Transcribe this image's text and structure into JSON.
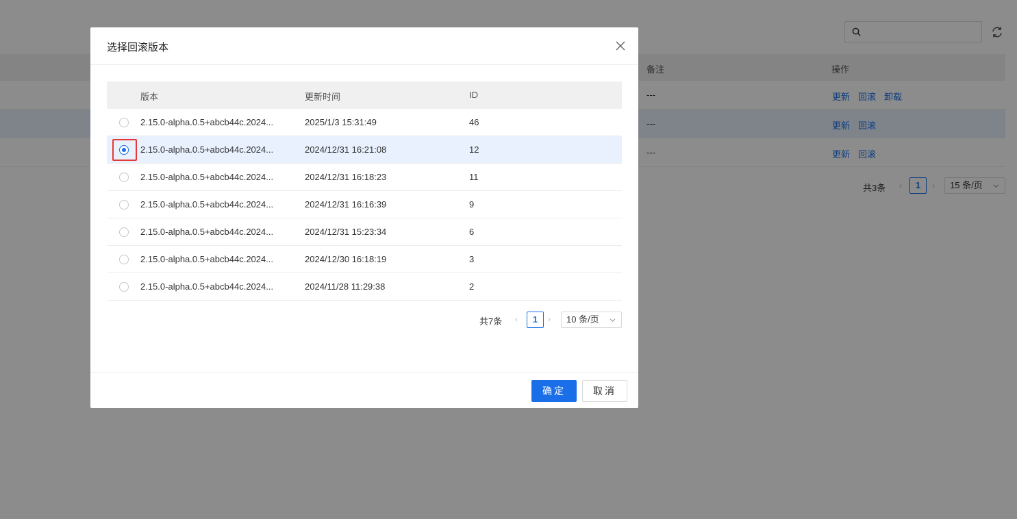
{
  "background": {
    "table_headers": {
      "remark": "备注",
      "actions": "操作"
    },
    "rows": [
      {
        "remark": "---",
        "actions": [
          "更新",
          "回滚",
          "卸载"
        ]
      },
      {
        "remark": "---",
        "actions": [
          "更新",
          "回滚"
        ]
      },
      {
        "remark": "---",
        "actions": [
          "更新",
          "回滚"
        ]
      }
    ],
    "pagination": {
      "total": "共3条",
      "page": "1",
      "page_size": "15 条/页"
    },
    "search_icon": "search-icon",
    "refresh_icon": "refresh-icon"
  },
  "modal": {
    "title": "选择回滚版本",
    "columns": {
      "version": "版本",
      "updated": "更新时间",
      "id": "ID"
    },
    "rows": [
      {
        "version": "2.15.0-alpha.0.5+abcb44c.2024...",
        "updated": "2025/1/3 15:31:49",
        "id": "46",
        "selected": false
      },
      {
        "version": "2.15.0-alpha.0.5+abcb44c.2024...",
        "updated": "2024/12/31 16:21:08",
        "id": "12",
        "selected": true
      },
      {
        "version": "2.15.0-alpha.0.5+abcb44c.2024...",
        "updated": "2024/12/31 16:18:23",
        "id": "11",
        "selected": false
      },
      {
        "version": "2.15.0-alpha.0.5+abcb44c.2024...",
        "updated": "2024/12/31 16:16:39",
        "id": "9",
        "selected": false
      },
      {
        "version": "2.15.0-alpha.0.5+abcb44c.2024...",
        "updated": "2024/12/31 15:23:34",
        "id": "6",
        "selected": false
      },
      {
        "version": "2.15.0-alpha.0.5+abcb44c.2024...",
        "updated": "2024/12/30 16:18:19",
        "id": "3",
        "selected": false
      },
      {
        "version": "2.15.0-alpha.0.5+abcb44c.2024...",
        "updated": "2024/11/28 11:29:38",
        "id": "2",
        "selected": false
      }
    ],
    "pagination": {
      "total": "共7条",
      "page": "1",
      "page_size": "10 条/页"
    },
    "ok_label": "确定",
    "cancel_label": "取消"
  },
  "colors": {
    "accent": "#1a6fe8",
    "highlight": "#e53935",
    "selected_row": "#e8f1fd"
  }
}
